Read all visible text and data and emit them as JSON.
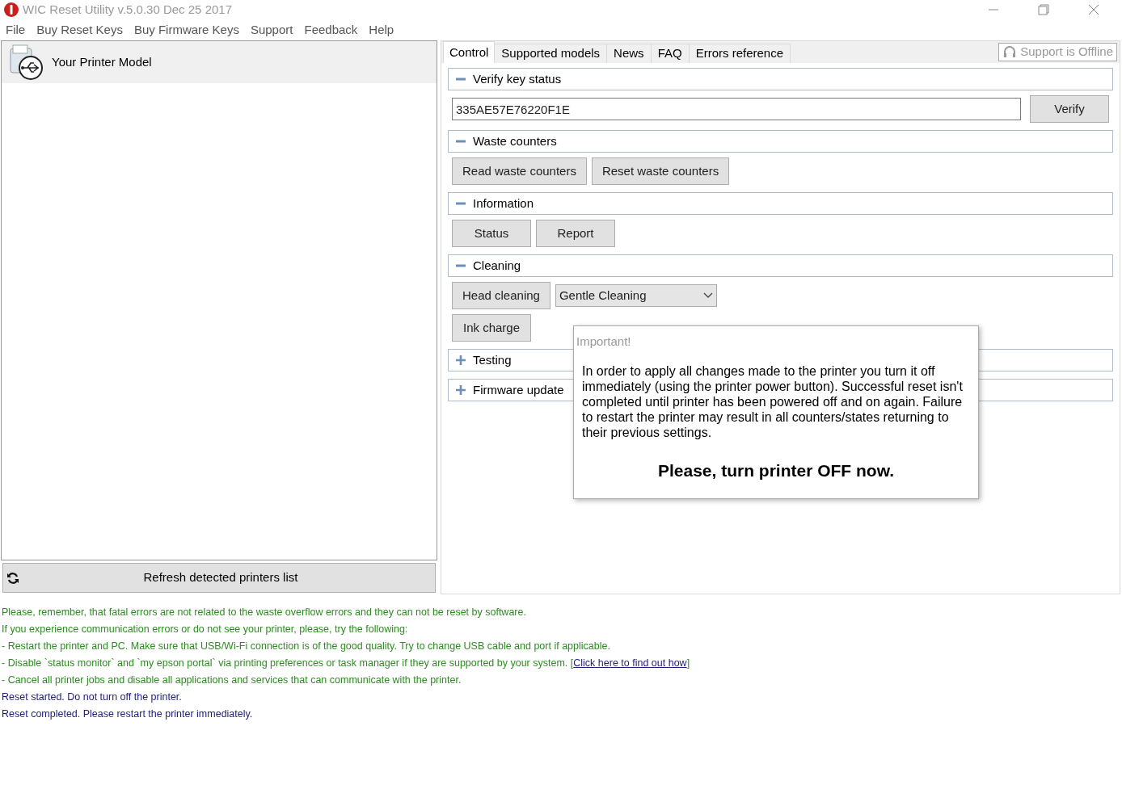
{
  "window": {
    "title": "WIC Reset Utility v.5.0.30 Dec 25 2017"
  },
  "menu": [
    "File",
    "Buy Reset Keys",
    "Buy Firmware Keys",
    "Support",
    "Feedback",
    "Help"
  ],
  "printers": {
    "header": "Your Printer Model",
    "refresh_button": "Refresh detected printers list"
  },
  "tabs": [
    {
      "label": "Control",
      "selected": true
    },
    {
      "label": "Supported models",
      "selected": false
    },
    {
      "label": "News",
      "selected": false
    },
    {
      "label": "FAQ",
      "selected": false
    },
    {
      "label": "Errors reference",
      "selected": false
    }
  ],
  "support_status": "Support is Offline",
  "sections": [
    {
      "title": "Verify key status",
      "expanded": true,
      "rows": [
        [
          {
            "kind": "field",
            "value": "335AE57E76220F1E"
          },
          {
            "kind": "button",
            "label": "Verify"
          }
        ]
      ]
    },
    {
      "title": "Waste counters",
      "expanded": true,
      "rows": [
        [
          {
            "kind": "button",
            "label": "Read waste counters"
          },
          {
            "kind": "button",
            "label": "Reset waste counters"
          }
        ]
      ]
    },
    {
      "title": "Information",
      "expanded": true,
      "rows": [
        [
          {
            "kind": "button",
            "label": "Status"
          },
          {
            "kind": "button",
            "label": "Report"
          }
        ]
      ]
    },
    {
      "title": "Cleaning",
      "expanded": true,
      "rows": [
        [
          {
            "kind": "button",
            "label": "Head cleaning"
          },
          {
            "kind": "select",
            "value": "Gentle Cleaning"
          }
        ],
        [
          {
            "kind": "button",
            "label": "Ink charge"
          }
        ]
      ]
    },
    {
      "title": "Testing",
      "expanded": false
    },
    {
      "title": "Firmware update",
      "expanded": false
    }
  ],
  "dialog": {
    "title": "Important!",
    "message": "In order to apply all changes made to the printer you turn it off immediately (using the printer power button). Successful reset isn't completed until printer has been powered off and on again. Failure to restart the printer may result in all counters/states returning to their previous settings.",
    "emphasis": "Please, turn printer OFF now."
  },
  "log": [
    {
      "kind": "hint",
      "text": "Please, remember, that fatal errors are not related to the waste overflow errors and they can not be reset by software."
    },
    {
      "kind": "hint",
      "text": "If you experience communication errors or do not see your printer, please, try the following:"
    },
    {
      "kind": "hint",
      "text": "- Restart the printer and PC. Make sure that USB/Wi-Fi connection is of the good quality. Try to change USB cable and port if applicable."
    },
    {
      "kind": "hint",
      "text": "- Disable `status monitor` and `my epson portal` via printing preferences or task manager if they are supported by your system. [",
      "link": "Click here to find out how",
      "after": "]"
    },
    {
      "kind": "hint",
      "text": "- Cancel all printer jobs  and disable all applications and services that can communicate with the printer."
    },
    {
      "kind": "status",
      "text": "Reset started. Do not turn off the printer."
    },
    {
      "kind": "status",
      "text": "Reset completed. Please restart the printer immediately."
    }
  ]
}
